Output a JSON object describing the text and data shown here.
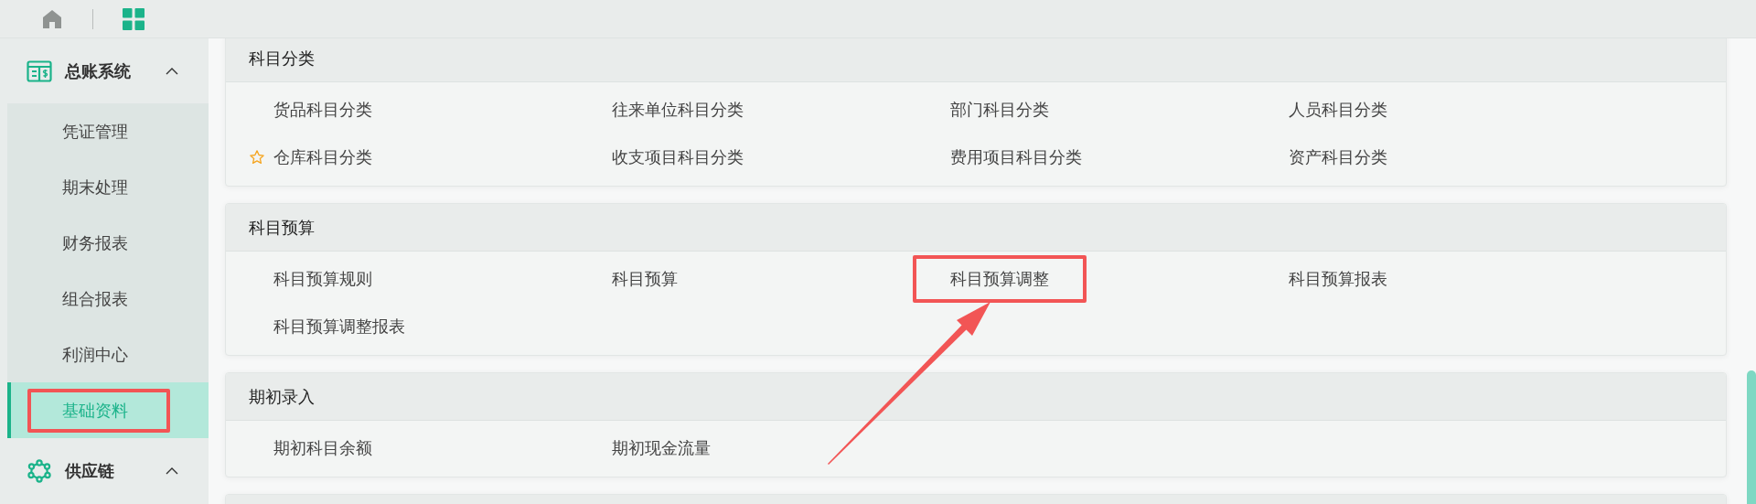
{
  "toolbar": {
    "items": [
      {
        "kind": "home",
        "selected": false
      },
      {
        "kind": "apps",
        "selected": true
      }
    ]
  },
  "sidebar": {
    "groups": [
      {
        "kind": "ledger",
        "title": "总账系统",
        "expanded": true,
        "items": [
          {
            "label": "凭证管理",
            "selected": false,
            "highlighted": false
          },
          {
            "label": "期末处理",
            "selected": false,
            "highlighted": false
          },
          {
            "label": "财务报表",
            "selected": false,
            "highlighted": false
          },
          {
            "label": "组合报表",
            "selected": false,
            "highlighted": false
          },
          {
            "label": "利润中心",
            "selected": false,
            "highlighted": false
          },
          {
            "label": "基础资料",
            "selected": true,
            "highlighted": true
          }
        ]
      },
      {
        "kind": "supply",
        "title": "供应链",
        "expanded": true
      }
    ]
  },
  "sections": [
    {
      "title": "科目分类",
      "items": [
        {
          "label": "货品科目分类",
          "starred": false,
          "highlighted": false
        },
        {
          "label": "往来单位科目分类",
          "starred": false,
          "highlighted": false
        },
        {
          "label": "部门科目分类",
          "starred": false,
          "highlighted": false
        },
        {
          "label": "人员科目分类",
          "starred": false,
          "highlighted": false
        },
        {
          "label": "仓库科目分类",
          "starred": true,
          "highlighted": false
        },
        {
          "label": "收支项目科目分类",
          "starred": false,
          "highlighted": false
        },
        {
          "label": "费用项目科目分类",
          "starred": false,
          "highlighted": false
        },
        {
          "label": "资产科目分类",
          "starred": false,
          "highlighted": false
        }
      ]
    },
    {
      "title": "科目预算",
      "items": [
        {
          "label": "科目预算规则",
          "starred": false,
          "highlighted": false
        },
        {
          "label": "科目预算",
          "starred": false,
          "highlighted": false
        },
        {
          "label": "科目预算调整",
          "starred": false,
          "highlighted": true
        },
        {
          "label": "科目预算报表",
          "starred": false,
          "highlighted": false
        },
        {
          "label": "科目预算调整报表",
          "starred": false,
          "highlighted": false
        }
      ]
    },
    {
      "title": "期初录入",
      "items": [
        {
          "label": "期初科目余额",
          "starred": false,
          "highlighted": false
        },
        {
          "label": "期初现金流量",
          "starred": false,
          "highlighted": false
        }
      ]
    }
  ],
  "annotations": [
    {
      "kind": "arrow"
    }
  ]
}
